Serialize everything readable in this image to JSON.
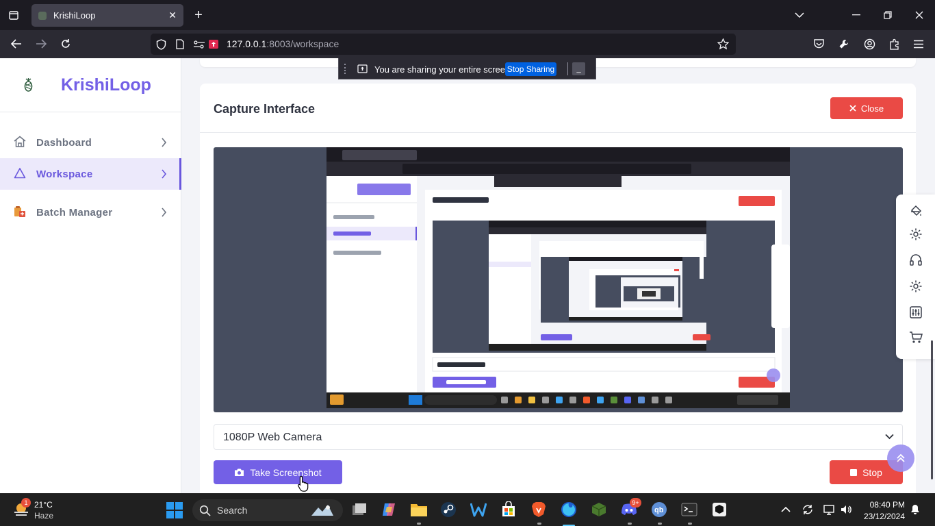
{
  "browser": {
    "tab_title": "KrishiLoop",
    "url_host": "127.0.0.1",
    "url_rest": ":8003/workspace"
  },
  "share_bar": {
    "message": "You are sharing your entire screen.",
    "stop_label": "Stop Sharing",
    "hide_label": "_"
  },
  "sidebar": {
    "brand": "KrishiLoop",
    "items": [
      {
        "label": "Dashboard",
        "icon": "home-icon",
        "active": false
      },
      {
        "label": "Workspace",
        "icon": "triangle-icon",
        "active": true
      },
      {
        "label": "Batch Manager",
        "icon": "batch-icon",
        "active": false
      }
    ]
  },
  "capture": {
    "title": "Capture Interface",
    "close_label": "Close",
    "camera_selected": "1080P Web Camera",
    "screenshot_label": "Take Screenshot",
    "stop_label": "Stop"
  },
  "taskbar": {
    "weather_temp": "21°C",
    "weather_desc": "Haze",
    "weather_badge": "1",
    "search_placeholder": "Search",
    "discord_badge": "9+",
    "time": "08:40 PM",
    "date": "23/12/2024"
  },
  "colors": {
    "brand": "#7360e6",
    "danger": "#ea4a45",
    "preview_bg": "#464d5f"
  }
}
